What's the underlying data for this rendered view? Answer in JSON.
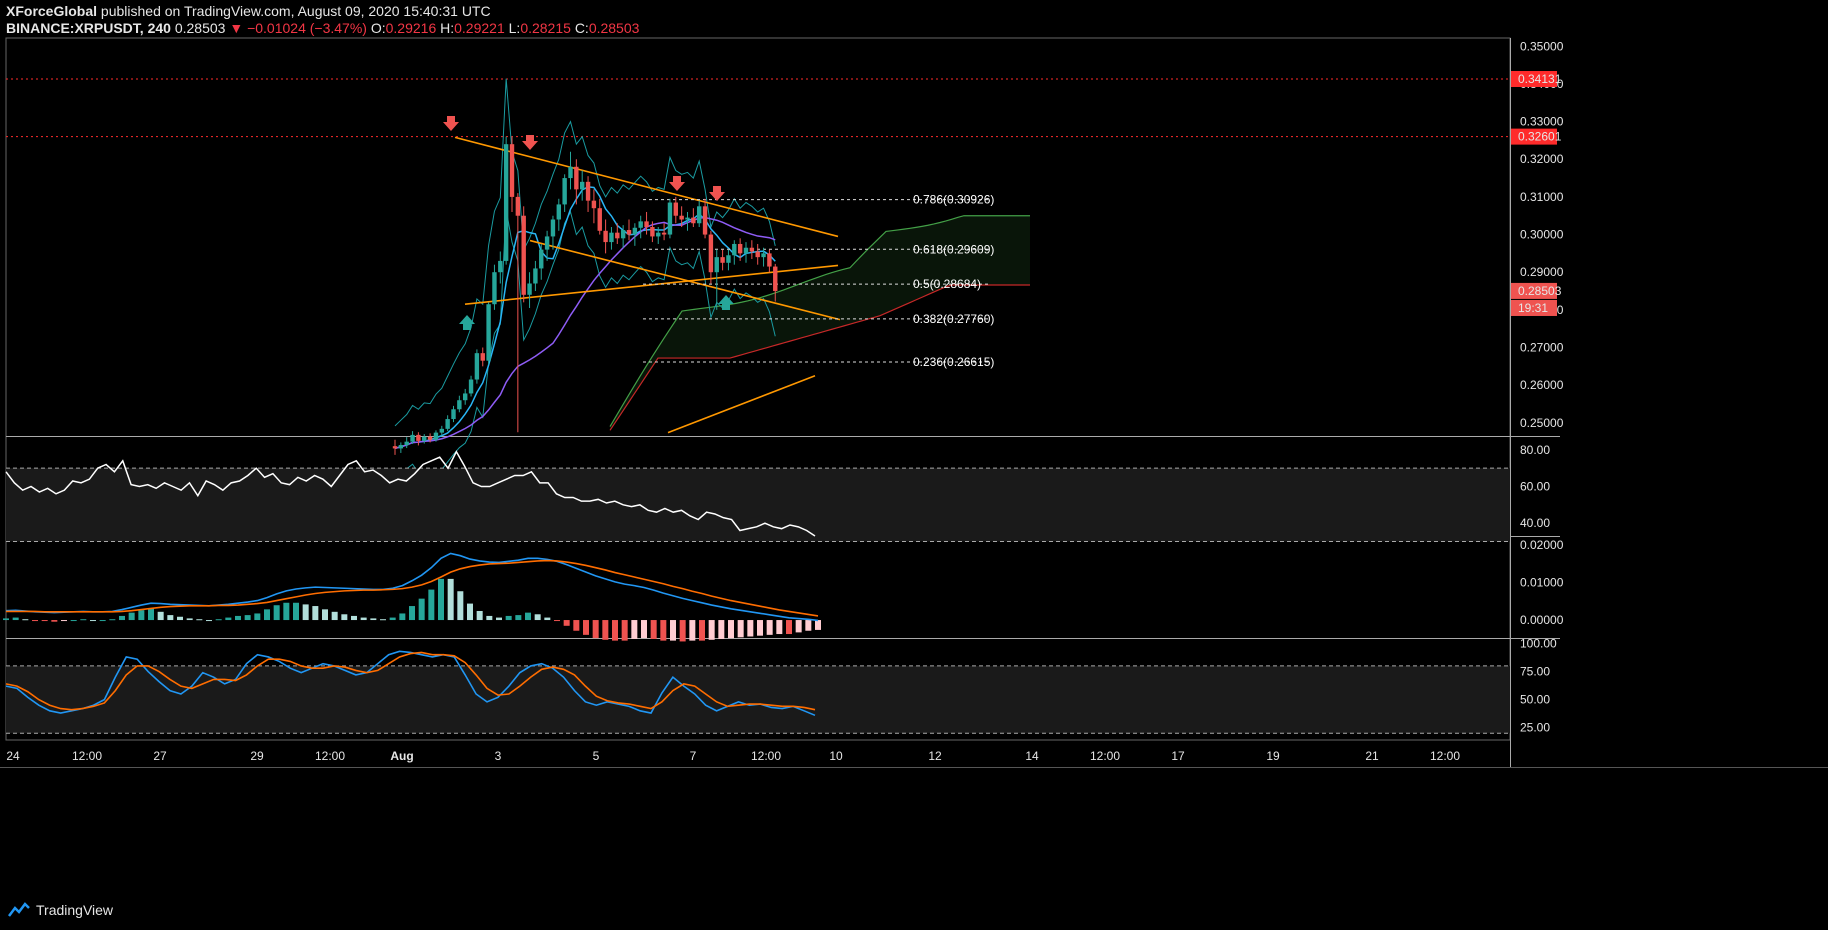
{
  "header": {
    "author": "XForceGlobal",
    "published": "published on TradingView.com, August 09, 2020 15:40:31 UTC",
    "symbol": "BINANCE:XRPUSDT, 240",
    "last": "0.28503",
    "arrow": "▼",
    "change": "−0.01024 (−3.47%)",
    "o_label": "O:",
    "o": "0.29216",
    "h_label": "H:",
    "h": "0.29221",
    "l_label": "L:",
    "l": "0.28215",
    "c_label": "C:",
    "c": "0.28503"
  },
  "brand": {
    "name": "TradingView",
    "icon": "tradingview-logo-icon"
  },
  "colors": {
    "up": "#26a69a",
    "down": "#ef5350",
    "bb": "#1a9ba1",
    "ma": "#29b6f6",
    "ma2": "#8e5cf5",
    "trend": "#ff9800",
    "cloudA": "#43a047",
    "cloudB": "#c62828",
    "rsi": "#ffffff",
    "macd": "#2196f3",
    "signal": "#ff6d00",
    "stoch_k": "#2196f3",
    "stoch_d": "#ff6d00",
    "level_red": "#ff2b2b"
  },
  "chart_data": {
    "type": "candlestick",
    "symbol": "BINANCE:XRPUSDT",
    "timeframe": "240",
    "price_axis": {
      "ticks": [
        "0.35000",
        "0.34000",
        "0.33000",
        "0.32000",
        "0.31000",
        "0.30000",
        "0.29000",
        "0.28000",
        "0.27000",
        "0.26000",
        "0.25000"
      ],
      "ylim": [
        0.2465,
        0.3522
      ],
      "badges": [
        {
          "label": "0.34131",
          "value": 0.34131,
          "color": "#ff2b2b"
        },
        {
          "label": "0.32601",
          "value": 0.32601,
          "color": "#ff2b2b"
        },
        {
          "label": "0.28503",
          "value": 0.28503,
          "color": "#ef5350"
        },
        {
          "label": "19:31",
          "value": 0.2805,
          "color": "#ef5350"
        }
      ]
    },
    "time_axis": {
      "labels": [
        "24",
        "12:00",
        "27",
        "29",
        "12:00",
        "Aug",
        "3",
        "5",
        "7",
        "12:00",
        "10",
        "12",
        "14",
        "12:00",
        "17",
        "19",
        "21",
        "12:00"
      ]
    },
    "horizontal_levels": [
      0.34131,
      0.32601
    ],
    "fibonacci": [
      {
        "label": "0.786(0.30926)",
        "value": 0.30926
      },
      {
        "label": "0.618(0.29609)",
        "value": 0.29609
      },
      {
        "label": "0.5(0.28684)",
        "value": 0.28684
      },
      {
        "label": "0.382(0.27760)",
        "value": 0.2776
      },
      {
        "label": "0.236(0.26615)",
        "value": 0.26615
      }
    ],
    "candles_ohlc": [
      [
        0.2438,
        0.2455,
        0.2415,
        0.2432
      ],
      [
        0.2432,
        0.2448,
        0.242,
        0.2441
      ],
      [
        0.2441,
        0.2462,
        0.2433,
        0.245
      ],
      [
        0.245,
        0.2478,
        0.2444,
        0.2468
      ],
      [
        0.2468,
        0.2475,
        0.244,
        0.2452
      ],
      [
        0.2452,
        0.247,
        0.2445,
        0.2463
      ],
      [
        0.2463,
        0.2472,
        0.2448,
        0.2455
      ],
      [
        0.2455,
        0.248,
        0.245,
        0.2474
      ],
      [
        0.2474,
        0.2492,
        0.2466,
        0.2484
      ],
      [
        0.2484,
        0.252,
        0.2478,
        0.251
      ],
      [
        0.251,
        0.2545,
        0.2502,
        0.2536
      ],
      [
        0.2536,
        0.2572,
        0.2528,
        0.256
      ],
      [
        0.256,
        0.259,
        0.2548,
        0.2578
      ],
      [
        0.2578,
        0.2625,
        0.257,
        0.2615
      ],
      [
        0.2615,
        0.2695,
        0.2604,
        0.2685
      ],
      [
        0.2685,
        0.27,
        0.265,
        0.2665
      ],
      [
        0.2665,
        0.282,
        0.2655,
        0.2815
      ],
      [
        0.2815,
        0.292,
        0.28,
        0.29
      ],
      [
        0.29,
        0.2955,
        0.287,
        0.293
      ],
      [
        0.293,
        0.326,
        0.292,
        0.324
      ],
      [
        0.324,
        0.326,
        0.306,
        0.31
      ],
      [
        0.31,
        0.311,
        0.2475,
        0.305
      ],
      [
        0.305,
        0.3075,
        0.282,
        0.284
      ],
      [
        0.284,
        0.29,
        0.2805,
        0.287
      ],
      [
        0.287,
        0.293,
        0.285,
        0.291
      ],
      [
        0.291,
        0.2975,
        0.288,
        0.296
      ],
      [
        0.296,
        0.301,
        0.293,
        0.2995
      ],
      [
        0.2995,
        0.305,
        0.296,
        0.304
      ],
      [
        0.304,
        0.3095,
        0.301,
        0.308
      ],
      [
        0.308,
        0.316,
        0.306,
        0.315
      ],
      [
        0.315,
        0.322,
        0.312,
        0.318
      ],
      [
        0.318,
        0.32,
        0.308,
        0.312
      ],
      [
        0.312,
        0.317,
        0.309,
        0.314
      ],
      [
        0.314,
        0.3155,
        0.306,
        0.309
      ],
      [
        0.309,
        0.312,
        0.303,
        0.307
      ],
      [
        0.307,
        0.3095,
        0.3,
        0.301
      ],
      [
        0.301,
        0.304,
        0.295,
        0.298
      ],
      [
        0.298,
        0.302,
        0.296,
        0.3005
      ],
      [
        0.3005,
        0.303,
        0.2975,
        0.299
      ],
      [
        0.299,
        0.3025,
        0.2965,
        0.3012
      ],
      [
        0.3012,
        0.304,
        0.2985,
        0.3
      ],
      [
        0.3,
        0.303,
        0.297,
        0.3018
      ],
      [
        0.3018,
        0.305,
        0.299,
        0.3035
      ],
      [
        0.3035,
        0.306,
        0.3,
        0.302
      ],
      [
        0.302,
        0.3035,
        0.298,
        0.2995
      ],
      [
        0.2995,
        0.302,
        0.2975,
        0.3005
      ],
      [
        0.3005,
        0.303,
        0.2985,
        0.3
      ],
      [
        0.3,
        0.3095,
        0.299,
        0.3085
      ],
      [
        0.3085,
        0.31,
        0.303,
        0.305
      ],
      [
        0.305,
        0.3075,
        0.302,
        0.304
      ],
      [
        0.304,
        0.306,
        0.301,
        0.3045
      ],
      [
        0.3045,
        0.307,
        0.302,
        0.303
      ],
      [
        0.303,
        0.309,
        0.302,
        0.3075
      ],
      [
        0.3075,
        0.3095,
        0.299,
        0.3
      ],
      [
        0.3,
        0.301,
        0.287,
        0.29
      ],
      [
        0.29,
        0.296,
        0.28,
        0.294
      ],
      [
        0.294,
        0.296,
        0.2905,
        0.2925
      ],
      [
        0.2925,
        0.296,
        0.2905,
        0.2945
      ],
      [
        0.2945,
        0.2985,
        0.292,
        0.2975
      ],
      [
        0.2975,
        0.299,
        0.293,
        0.295
      ],
      [
        0.295,
        0.298,
        0.2925,
        0.2965
      ],
      [
        0.2965,
        0.2985,
        0.2935,
        0.2955
      ],
      [
        0.2955,
        0.2975,
        0.292,
        0.294
      ],
      [
        0.294,
        0.2965,
        0.2915,
        0.295
      ],
      [
        0.295,
        0.296,
        0.29,
        0.2915
      ],
      [
        0.2915,
        0.2922,
        0.2822,
        0.285
      ]
    ],
    "rsi": {
      "ticks": [
        "80.00",
        "60.00",
        "40.00"
      ],
      "ylim": [
        33,
        87
      ],
      "bands": [
        70,
        30
      ],
      "values": [
        68,
        62,
        58,
        60,
        57,
        59,
        56,
        58,
        63,
        62,
        64,
        70,
        72,
        68,
        74,
        61,
        60,
        61,
        59,
        62,
        60,
        58,
        62,
        55,
        63,
        61,
        58,
        62,
        63,
        66,
        70,
        65,
        67,
        62,
        61,
        65,
        63,
        66,
        64,
        60,
        66,
        72,
        74,
        68,
        69,
        66,
        62,
        64,
        63,
        67,
        72,
        74,
        76,
        70,
        79,
        71,
        62,
        60,
        60,
        62,
        64,
        66,
        66,
        68,
        62,
        62,
        56,
        54,
        54,
        52,
        52,
        53,
        51,
        52,
        50,
        49,
        50,
        47,
        46,
        48,
        46,
        47,
        44,
        42,
        46,
        45,
        43,
        42,
        36,
        37,
        38,
        40,
        38,
        37,
        39,
        38,
        36,
        33
      ]
    },
    "macd": {
      "ticks": [
        "0.02000",
        "0.01000",
        "0.00000"
      ],
      "ylim": [
        -0.0048,
        0.0222
      ],
      "macd_values": [
        0.0025,
        0.0026,
        0.0024,
        0.0022,
        0.0021,
        0.002,
        0.0021,
        0.0022,
        0.0023,
        0.0022,
        0.0022,
        0.0023,
        0.0028,
        0.0034,
        0.004,
        0.0045,
        0.0044,
        0.0042,
        0.0041,
        0.004,
        0.0039,
        0.0038,
        0.004,
        0.0042,
        0.0045,
        0.0048,
        0.0052,
        0.006,
        0.007,
        0.0078,
        0.0083,
        0.0086,
        0.0088,
        0.0087,
        0.0086,
        0.0085,
        0.0084,
        0.0083,
        0.0082,
        0.0082,
        0.0085,
        0.0092,
        0.0105,
        0.012,
        0.014,
        0.0165,
        0.0178,
        0.0172,
        0.0163,
        0.0158,
        0.0155,
        0.0154,
        0.0157,
        0.016,
        0.0165,
        0.0165,
        0.0162,
        0.0157,
        0.0148,
        0.0138,
        0.0128,
        0.0118,
        0.011,
        0.0102,
        0.0096,
        0.0092,
        0.0087,
        0.008,
        0.0072,
        0.0065,
        0.0058,
        0.0052,
        0.0046,
        0.004,
        0.0035,
        0.003,
        0.0026,
        0.0022,
        0.0018,
        0.0014,
        0.001,
        0.0006,
        0.0004,
        0.0002,
        -0.0001
      ],
      "signal_values": [
        0.0023,
        0.0023,
        0.0023,
        0.0023,
        0.0022,
        0.0022,
        0.0022,
        0.0022,
        0.0022,
        0.0022,
        0.0022,
        0.0022,
        0.0023,
        0.0025,
        0.0028,
        0.0031,
        0.0034,
        0.0036,
        0.0037,
        0.0038,
        0.0038,
        0.0038,
        0.0039,
        0.0039,
        0.004,
        0.0042,
        0.0044,
        0.0047,
        0.0052,
        0.0057,
        0.0062,
        0.0067,
        0.0071,
        0.0074,
        0.0076,
        0.0078,
        0.0079,
        0.008,
        0.008,
        0.0081,
        0.0082,
        0.0084,
        0.0088,
        0.0094,
        0.0103,
        0.0115,
        0.0128,
        0.0137,
        0.0143,
        0.0147,
        0.015,
        0.0151,
        0.0152,
        0.0154,
        0.0156,
        0.0158,
        0.0159,
        0.0158,
        0.0155,
        0.0151,
        0.0146,
        0.014,
        0.0134,
        0.0127,
        0.0121,
        0.0115,
        0.0109,
        0.0103,
        0.0097,
        0.009,
        0.0084,
        0.0077,
        0.0071,
        0.0064,
        0.0058,
        0.0052,
        0.0047,
        0.0042,
        0.0037,
        0.0032,
        0.0027,
        0.0023,
        0.0019,
        0.0015,
        0.0011
      ]
    },
    "stoch": {
      "ticks": [
        "100.00",
        "75.00",
        "50.00",
        "25.00"
      ],
      "ylim": [
        14,
        104
      ],
      "bands": [
        80,
        20
      ],
      "k_values": [
        62,
        60,
        52,
        45,
        40,
        38,
        40,
        42,
        45,
        50,
        70,
        88,
        86,
        75,
        66,
        58,
        55,
        62,
        74,
        70,
        64,
        68,
        82,
        90,
        88,
        84,
        78,
        74,
        78,
        82,
        80,
        76,
        72,
        74,
        82,
        90,
        93,
        92,
        90,
        88,
        90,
        88,
        72,
        55,
        48,
        52,
        62,
        74,
        80,
        82,
        78,
        70,
        58,
        48,
        45,
        48,
        46,
        44,
        40,
        38,
        56,
        70,
        62,
        55,
        45,
        40,
        44,
        48,
        45,
        46,
        43,
        42,
        44,
        40,
        36
      ],
      "d_values": [
        64,
        62,
        57,
        50,
        45,
        42,
        41,
        42,
        44,
        47,
        58,
        72,
        80,
        80,
        75,
        68,
        62,
        60,
        64,
        68,
        68,
        67,
        72,
        80,
        86,
        86,
        84,
        80,
        78,
        78,
        80,
        79,
        76,
        74,
        76,
        82,
        88,
        91,
        92,
        90,
        90,
        89,
        83,
        72,
        60,
        54,
        55,
        62,
        70,
        77,
        79,
        77,
        72,
        62,
        53,
        49,
        47,
        46,
        44,
        42,
        48,
        58,
        64,
        62,
        55,
        48,
        44,
        45,
        46,
        46,
        45,
        44,
        44,
        43,
        41
      ]
    }
  }
}
